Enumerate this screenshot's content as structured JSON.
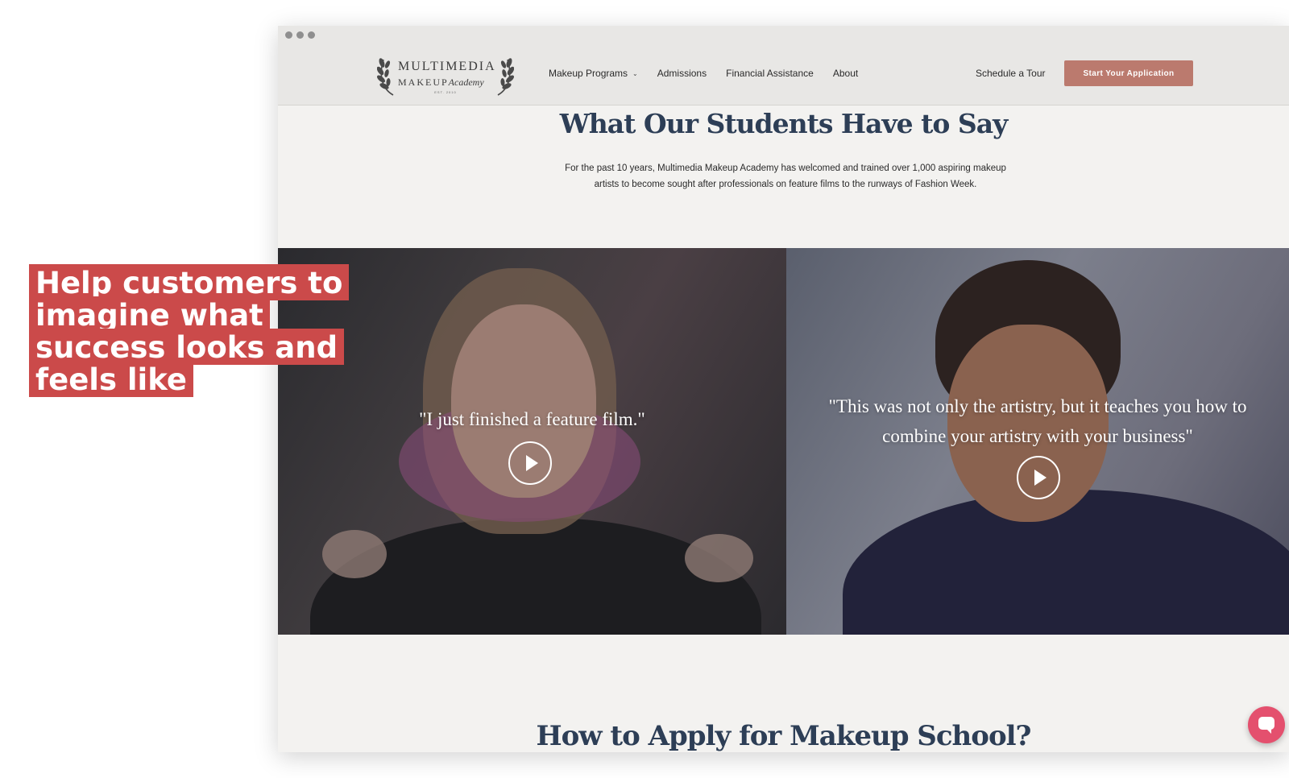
{
  "callout": {
    "text": "Help customers to imagine what success looks and feels like"
  },
  "site": {
    "logo": {
      "line1": "MULTIMEDIA",
      "line2": "MAKEUP",
      "line2_script": "Academy",
      "est": "EST. 2010"
    },
    "nav": {
      "items": [
        {
          "label": "Makeup Programs",
          "has_dropdown": true
        },
        {
          "label": "Admissions"
        },
        {
          "label": "Financial Assistance"
        },
        {
          "label": "About"
        }
      ],
      "tour_label": "Schedule a Tour",
      "apply_label": "Start Your Application"
    },
    "testimonials": {
      "title": "What Our Students Have to Say",
      "intro": "For the past 10 years, Multimedia Makeup Academy has welcomed and trained over 1,000 aspiring makeup artists to become sought after professionals on feature films to the runways of Fashion Week.",
      "videos": [
        {
          "quote": "\"I just finished a feature film.\""
        },
        {
          "quote": "\"This was not only the artistry, but it teaches you how to combine your artistry with your business\""
        }
      ]
    },
    "next_section_title": "How to Apply for Makeup School?"
  },
  "colors": {
    "accent_button": "#bb7a6e",
    "heading": "#2d3e56",
    "callout_bg": "#cb4a4a",
    "chat_button": "#e4506e"
  },
  "icons": [
    "laurel-icon",
    "chevron-down-icon",
    "play-icon",
    "chat-icon"
  ]
}
